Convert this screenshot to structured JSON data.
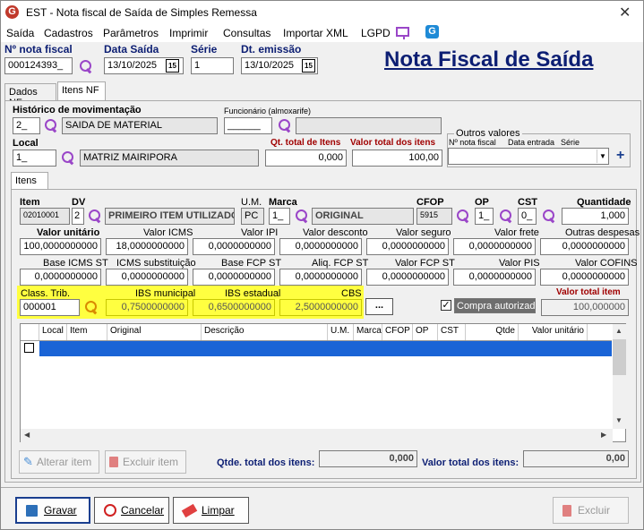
{
  "window": {
    "title": "EST - Nota fiscal de Saída de Simples Remessa",
    "close": "✕"
  },
  "menu": [
    "Saída",
    "Cadastros",
    "Parâmetros",
    "Imprimir",
    "Consultas",
    "Importar XML",
    "LGPD"
  ],
  "header": {
    "nota_label": "Nº nota fiscal",
    "nota_value": "000124393_",
    "data_saida_label": "Data Saída",
    "data_saida_value": "13/10/2025",
    "serie_label": "Série",
    "serie_value": "1",
    "dt_emissao_label": "Dt. emissão",
    "dt_emissao_value": "13/10/2025",
    "big_title": "Nota Fiscal de Saída",
    "cal_glyph": "15"
  },
  "tabs": {
    "dados": "Dados NF",
    "itens": "Itens NF",
    "inner": "Itens"
  },
  "mov": {
    "hist_label": "Histórico de movimentação",
    "hist_code": "2_",
    "hist_desc": "SAIDA DE MATERIAL",
    "func_label": "Funcionário (almoxarife)",
    "func_code": "______",
    "local_label": "Local",
    "local_code": "1_",
    "local_desc": "MATRIZ MAIRIPORA",
    "qt_total_label": "Qt. total de Itens",
    "qt_total_value": "0,000",
    "valor_total_label": "Valor total dos itens",
    "valor_total_value": "100,00",
    "outros_title": "Outros valores",
    "outros_nf": "Nº nota fiscal",
    "outros_data": "Data entrada",
    "outros_serie": "Série",
    "plus": "+"
  },
  "item": {
    "item_label": "Item",
    "item_value": "02010001",
    "dv_label": "DV",
    "dv_value": "2",
    "desc_value": "PRIMEIRO ITEM UTILIZADO",
    "um_label": "U.M.",
    "um_value": "PC",
    "marca_label": "Marca",
    "marca_code": "1_",
    "marca_value": "ORIGINAL",
    "cfop_label": "CFOP",
    "cfop_value": "5915",
    "op_label": "OP",
    "op_value": "1_",
    "cst_label": "CST",
    "cst_value": "0_",
    "qtd_label": "Quantidade",
    "qtd_value": "1,000"
  },
  "values_row1": [
    {
      "label": "Valor unitário",
      "value": "100,0000000000"
    },
    {
      "label": "Valor ICMS",
      "value": "18,0000000000"
    },
    {
      "label": "Valor IPI",
      "value": "0,0000000000"
    },
    {
      "label": "Valor desconto",
      "value": "0,0000000000"
    },
    {
      "label": "Valor seguro",
      "value": "0,0000000000"
    },
    {
      "label": "Valor frete",
      "value": "0,0000000000"
    },
    {
      "label": "Outras despesas",
      "value": "0,0000000000"
    }
  ],
  "values_row2": [
    {
      "label": "Base ICMS ST",
      "value": "0,0000000000"
    },
    {
      "label": "ICMS substituição",
      "value": "0,0000000000"
    },
    {
      "label": "Base FCP ST",
      "value": "0,0000000000"
    },
    {
      "label": "Aliq. FCP ST",
      "value": "0,0000000000"
    },
    {
      "label": "Valor FCP ST",
      "value": "0,0000000000"
    },
    {
      "label": "Valor PIS",
      "value": "0,0000000000"
    },
    {
      "label": "Valor COFINS",
      "value": "0,0000000000"
    }
  ],
  "trib": {
    "class_label": "Class. Trib.",
    "class_value": "000001",
    "ibs_mun_label": "IBS municipal",
    "ibs_mun_value": "0,7500000000",
    "ibs_est_label": "IBS estadual",
    "ibs_est_value": "0,6500000000",
    "cbs_label": "CBS",
    "cbs_value": "2,5000000000",
    "more_btn": "...",
    "compra_label": "Compra autorizada",
    "compra_check": "✓",
    "valor_item_label": "Valor total item",
    "valor_item_value": "100,000000"
  },
  "grid": {
    "columns": [
      "Local",
      "Item",
      "Original",
      "Descrição",
      "U.M.",
      "Marca",
      "CFOP",
      "OP",
      "CST",
      "Qtde",
      "Valor unitário"
    ]
  },
  "grid_actions": {
    "alterar": "Alterar item",
    "excluir": "Excluir item",
    "qtde_total_label": "Qtde. total dos itens:",
    "qtde_total_value": "0,000",
    "valor_total_label": "Valor total dos itens:",
    "valor_total_value": "0,00"
  },
  "footer": {
    "gravar": "Gravar",
    "cancelar": "Cancelar",
    "limpar": "Limpar",
    "excluir": "Excluir"
  },
  "colors": {
    "accent": "#0c1e73",
    "highlight": "#ffff40",
    "label_red": "#a00000",
    "icon_purple": "#9a46c8",
    "selected_row": "#1a64d6"
  }
}
